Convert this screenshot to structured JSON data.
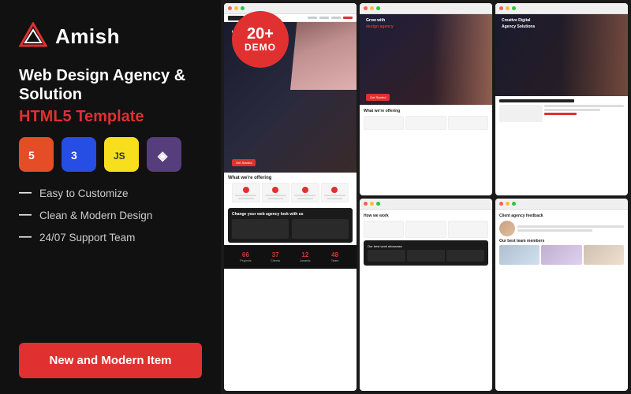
{
  "left": {
    "logo_text": "Amish",
    "heading_main": "Web Design Agency & Solution",
    "heading_sub": "HTML5 Template",
    "tech_icons": [
      {
        "label": "HTML5",
        "class": "tech-html",
        "symbol": "5"
      },
      {
        "label": "CSS3",
        "class": "tech-css",
        "symbol": "3"
      },
      {
        "label": "JS",
        "class": "tech-js",
        "symbol": "JS"
      },
      {
        "label": "Bootstrap",
        "class": "tech-bootstrap",
        "symbol": "◈"
      }
    ],
    "features": [
      "Easy to Customize",
      "Clean & Modern Design",
      "24/07 Support Team"
    ],
    "cta_label": "New and Modern Item"
  },
  "right": {
    "demo_number": "20+",
    "demo_label": "DEMO"
  }
}
